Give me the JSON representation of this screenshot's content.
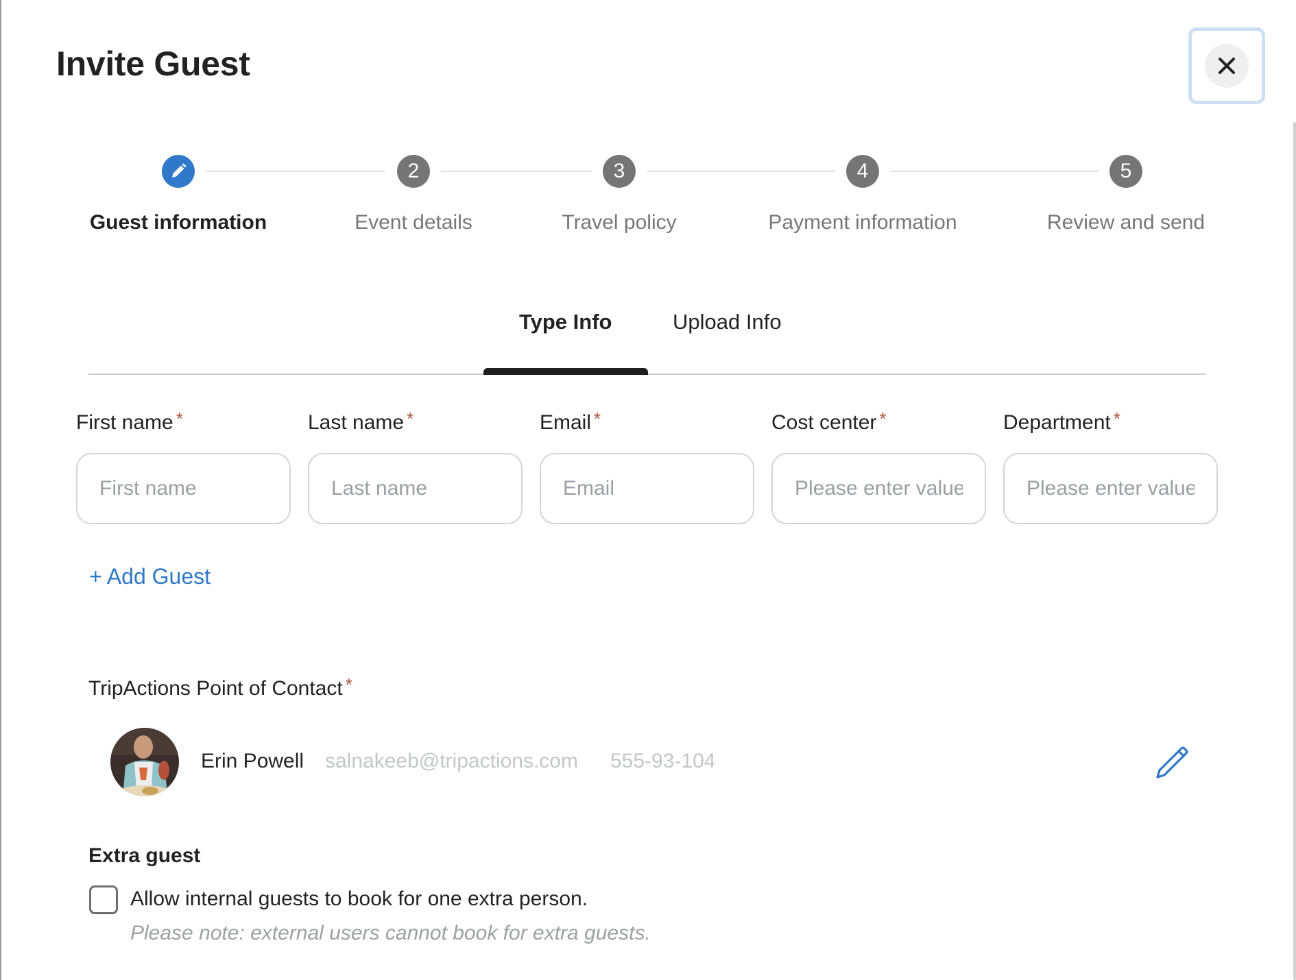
{
  "dialog": {
    "title": "Invite Guest",
    "close_label": "Close"
  },
  "stepper": {
    "steps": [
      {
        "number": "",
        "label": "Guest information",
        "state": "active",
        "icon": "pencil-icon"
      },
      {
        "number": "2",
        "label": "Event details",
        "state": "pending"
      },
      {
        "number": "3",
        "label": "Travel policy",
        "state": "pending"
      },
      {
        "number": "4",
        "label": "Payment information",
        "state": "pending"
      },
      {
        "number": "5",
        "label": "Review and send",
        "state": "pending"
      }
    ]
  },
  "tabs": [
    {
      "label": "Type Info",
      "active": true
    },
    {
      "label": "Upload Info",
      "active": false
    }
  ],
  "fields": [
    {
      "label": "First name",
      "required_mark": "*",
      "placeholder": "First name",
      "value": ""
    },
    {
      "label": "Last name",
      "required_mark": "*",
      "placeholder": "Last name",
      "value": ""
    },
    {
      "label": "Email",
      "required_mark": "*",
      "placeholder": "Email",
      "value": ""
    },
    {
      "label": "Cost center",
      "required_mark": "*",
      "placeholder": "Please enter value",
      "value": ""
    },
    {
      "label": "Department",
      "required_mark": "*",
      "placeholder": "Please enter value",
      "value": ""
    }
  ],
  "add_guest_label": "+ Add Guest",
  "point_of_contact": {
    "label": "TripActions Point of Contact",
    "required_mark": "*",
    "name": "Erin Powell",
    "email": "salnakeeb@tripactions.com",
    "phone": "555-93-104",
    "edit_icon": "pencil-icon"
  },
  "extra_guest": {
    "title": "Extra guest",
    "checkbox_label": "Allow internal guests to book for one extra person.",
    "checked": false,
    "note": "Please note: external users cannot book for extra guests."
  },
  "colors": {
    "accent": "#3078c9",
    "link": "#2f78c8",
    "required": "#a9523f",
    "step_pending": "#757575"
  }
}
